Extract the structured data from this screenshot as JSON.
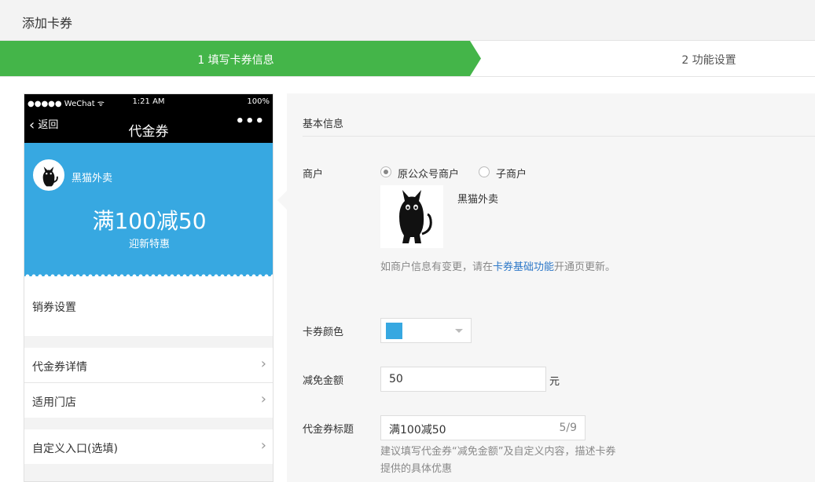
{
  "page": {
    "title": "添加卡券"
  },
  "steps": [
    {
      "label": "1 填写卡券信息",
      "active": true
    },
    {
      "label": "2 功能设置",
      "active": false
    }
  ],
  "colors": {
    "step_active": "#44b549",
    "card": "#37a8e1",
    "link": "#2d78c8"
  },
  "phone": {
    "status_left": "●●●●● WeChat ᯤ",
    "status_time": "1:21 AM",
    "status_right": "100%",
    "back_label": "返回",
    "title": "代金券",
    "menu_icon": "more-dots-icon",
    "card": {
      "merchant_name": "黑猫外卖",
      "headline": "满100减50",
      "subtitle": "迎新特惠"
    },
    "rows": [
      {
        "label": "销券设置"
      },
      {
        "label": "代金券详情"
      },
      {
        "label": "适用门店"
      },
      {
        "label": "自定义入口(选填)"
      }
    ]
  },
  "form": {
    "section_title": "基本信息",
    "merchant": {
      "label": "商户",
      "options": [
        {
          "label": "原公众号商户",
          "checked": true
        },
        {
          "label": "子商户",
          "checked": false
        }
      ],
      "name": "黑猫外卖",
      "hint_before": "如商户信息有变更，请在",
      "hint_link": "卡券基础功能",
      "hint_after": "开通页更新。"
    },
    "card_color": {
      "label": "卡券颜色",
      "value": "#37a8e1"
    },
    "discount": {
      "label": "减免金额",
      "value": "50",
      "unit": "元"
    },
    "coupon_title": {
      "label": "代金券标题",
      "value": "满100减50",
      "counter": "5/9",
      "hint": "建议填写代金券“减免金额”及自定义内容，描述卡券提供的具体优惠"
    }
  }
}
